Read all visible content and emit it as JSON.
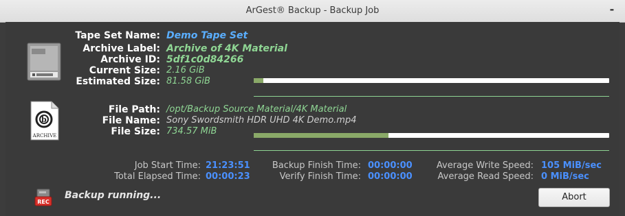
{
  "window": {
    "title": "ArGest® Backup - Backup Job",
    "minimize_glyph": "-"
  },
  "tape": {
    "labels": {
      "set_name": "Tape Set Name:",
      "archive_label": "Archive Label:",
      "archive_id": "Archive ID:",
      "current_size": "Current Size:",
      "estimated_size": "Estimated Size:"
    },
    "values": {
      "set_name": "Demo Tape Set",
      "archive_label": "Archive of 4K Material",
      "archive_id": "5df1c0d84266",
      "current_size": "2.16 GiB",
      "estimated_size": "81.58 GiB"
    },
    "progress_fraction": 0.0265
  },
  "file": {
    "labels": {
      "path": "File Path:",
      "name": "File Name:",
      "size": "File Size:"
    },
    "values": {
      "path": "/opt/Backup Source Material/4K Material",
      "name": "Sony Swordsmith HDR UHD 4K Demo.mp4",
      "size": "734.57 MiB"
    },
    "progress_fraction": 0.38,
    "icon_caption": "ARCHIVE"
  },
  "stats": {
    "job_start_label": "Job Start Time:",
    "job_start": "21:23:51",
    "elapsed_label": "Total Elapsed Time:",
    "elapsed": "00:00:23",
    "backup_finish_label": "Backup Finish Time:",
    "backup_finish": "00:00:00",
    "verify_finish_label": "Verify Finish Time:",
    "verify_finish": "00:00:00",
    "avg_write_label": "Average Write Speed:",
    "avg_write": "105 MiB/sec",
    "avg_read_label": "Average Read Speed:",
    "avg_read": "0 MiB/sec"
  },
  "status": {
    "text": "Backup running...",
    "rec_badge": "REC"
  },
  "buttons": {
    "abort": "Abort"
  },
  "icons": {
    "tape": "tape-cartridge-icon",
    "archive": "archive-document-icon",
    "rec": "rec-drive-icon"
  },
  "colors": {
    "background": "#3a3a3a",
    "label": "#ffffff",
    "value_green": "#8fd694",
    "value_blue": "#5aaeff",
    "stat_blue": "#4a90ff",
    "rec_red": "#d9302a"
  }
}
